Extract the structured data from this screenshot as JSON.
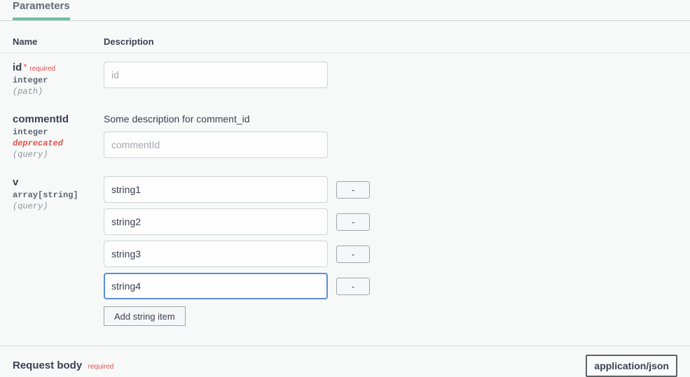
{
  "tab": {
    "label": "Parameters"
  },
  "headers": {
    "name": "Name",
    "description": "Description"
  },
  "params": [
    {
      "name": "id",
      "required_star": "*",
      "required_text": "required",
      "type": "integer",
      "location": "(path)",
      "placeholder": "id",
      "value": ""
    },
    {
      "name": "commentId",
      "type": "integer",
      "deprecated": "deprecated",
      "location": "(query)",
      "description": "Some description for comment_id",
      "placeholder": "commentId",
      "value": ""
    },
    {
      "name": "v",
      "type": "array[string]",
      "location": "(query)",
      "items": [
        {
          "value": "string1"
        },
        {
          "value": "string2"
        },
        {
          "value": "string3"
        },
        {
          "value": "string4"
        }
      ],
      "remove_label": "-",
      "add_label": "Add string item"
    }
  ],
  "request_body": {
    "label": "Request body",
    "required": "required",
    "content_type": "application/json"
  }
}
